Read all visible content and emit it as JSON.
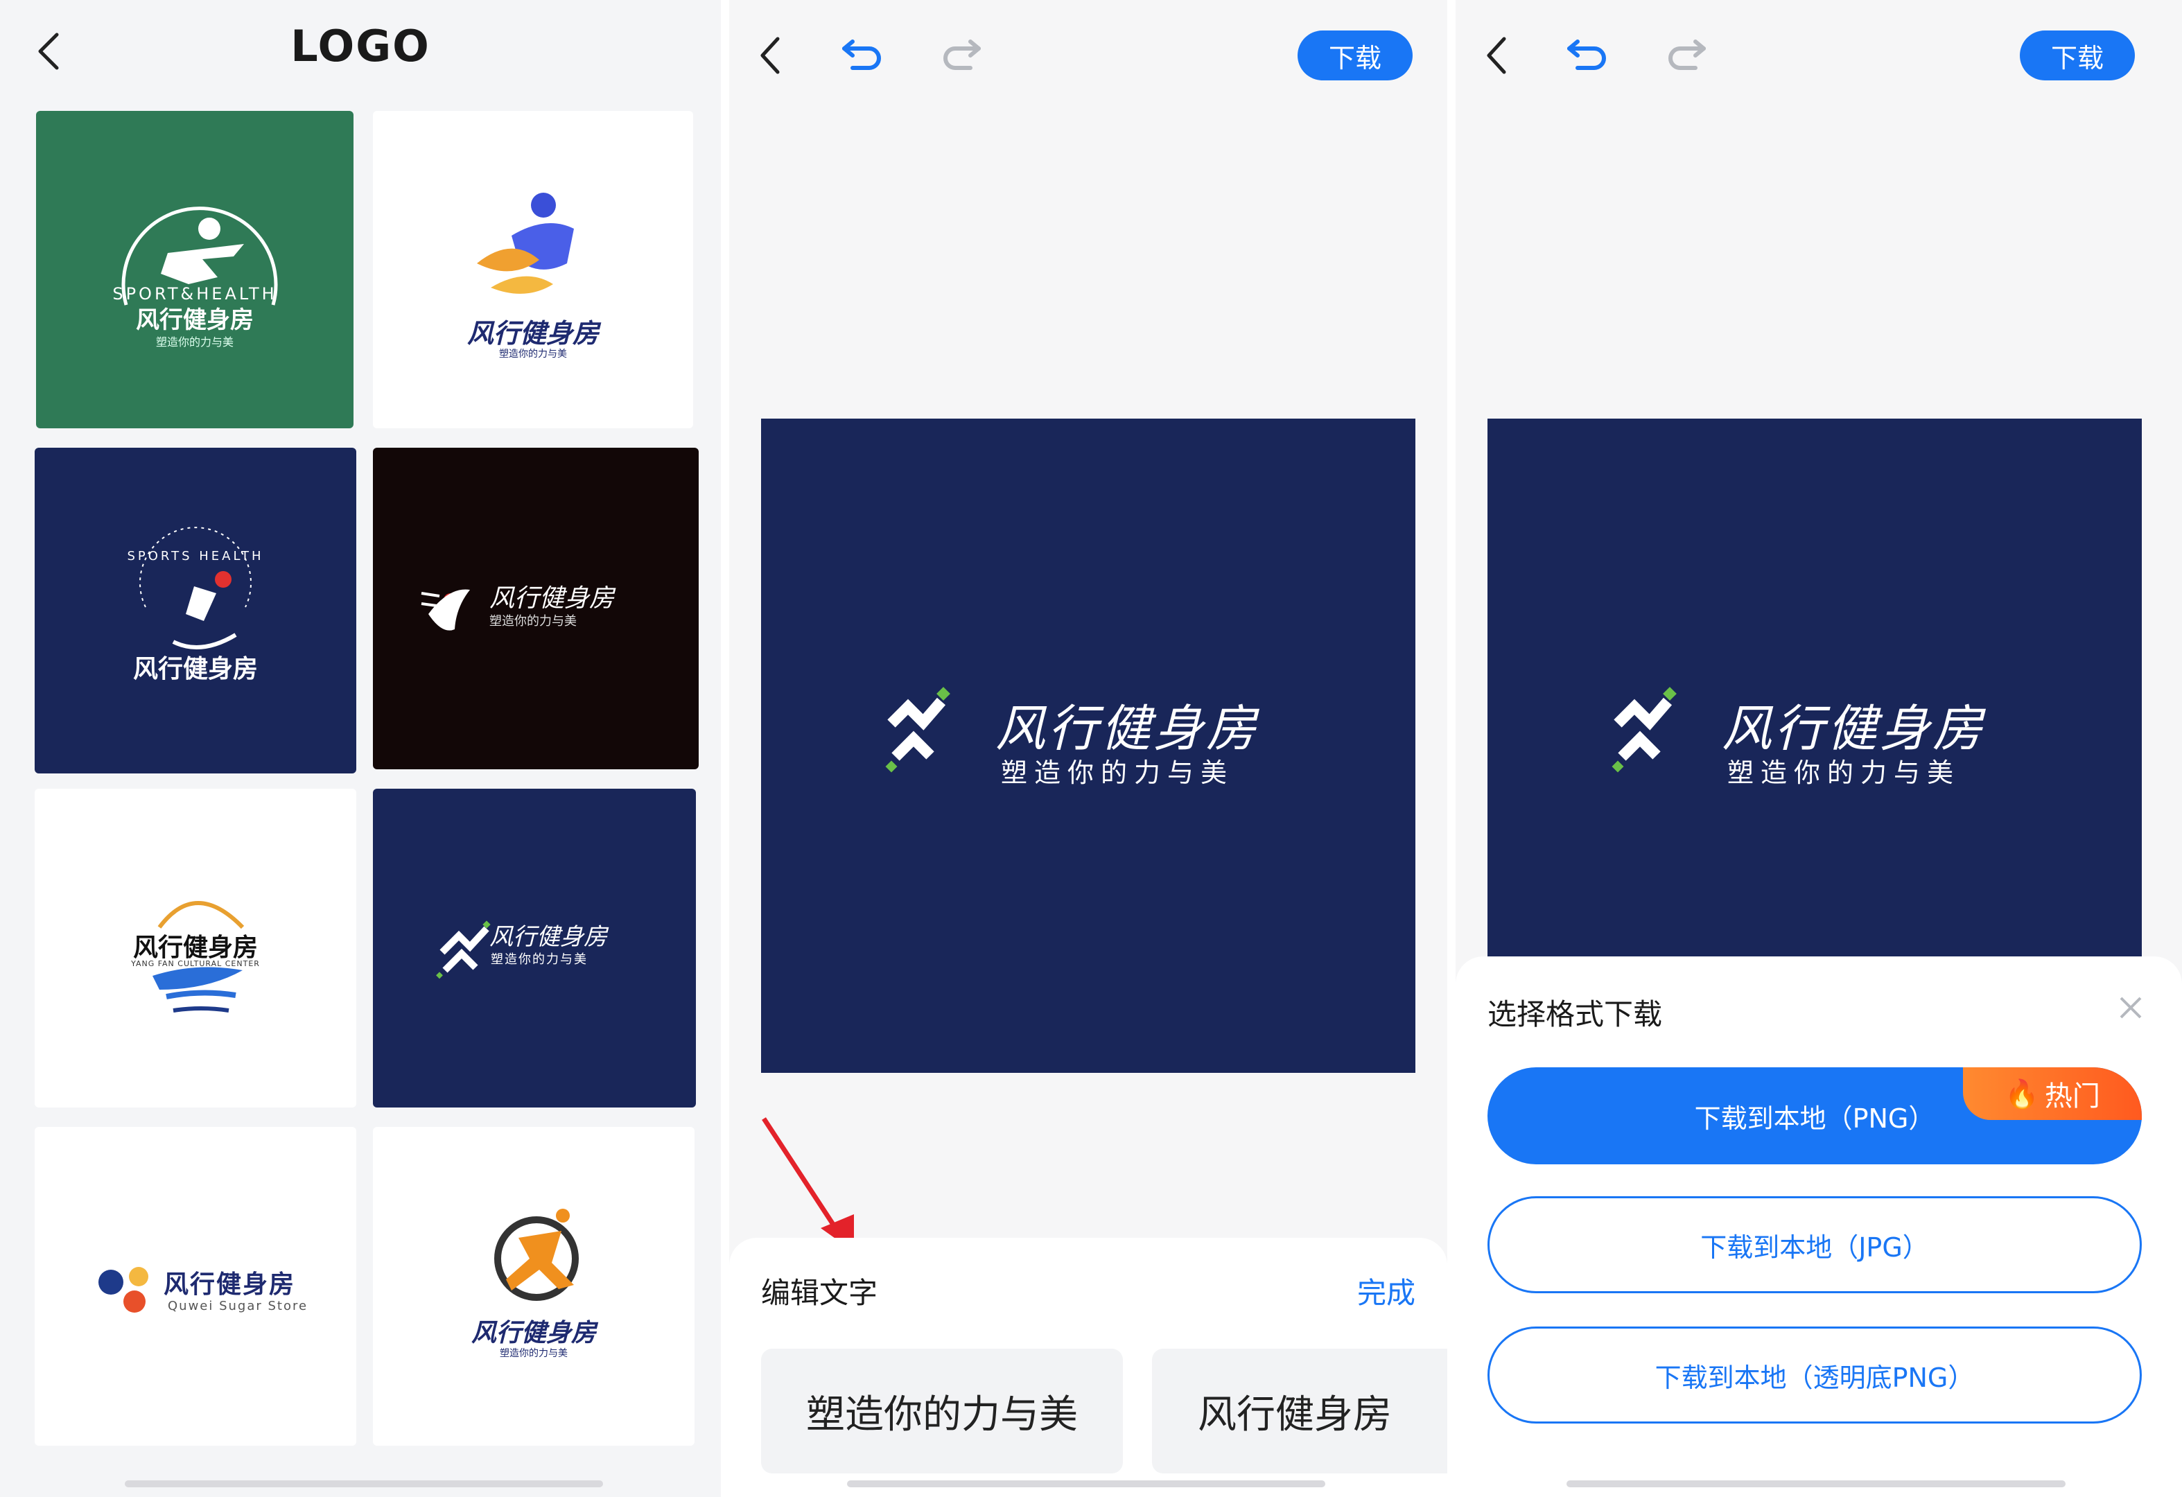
{
  "panel_logo_list": {
    "title": "LOGO",
    "tiles": [
      {
        "name": "风行健身房",
        "tagline": "塑造你的力与美",
        "arc_text": "SPORT&HEALTH",
        "bg": "#2f7a56"
      },
      {
        "name": "风行健身房",
        "tagline": "塑造你的力与美",
        "bg": "#ffffff"
      },
      {
        "name": "风行健身房",
        "arc_text": "SPORTS HEALTH",
        "bg": "#192659"
      },
      {
        "name": "风行健身房",
        "tagline": "塑造你的力与美",
        "bg": "#120707"
      },
      {
        "name": "风行健身房",
        "tagline": "YANG FAN CULTURAL CENTER",
        "bg": "#ffffff"
      },
      {
        "name": "风行健身房",
        "tagline": "塑造你的力与美",
        "bg": "#192659"
      },
      {
        "name": "风行健身房",
        "tagline": "Quwei Sugar Store",
        "bg": "#ffffff"
      },
      {
        "name": "风行健身房",
        "tagline": "塑造你的力与美",
        "bg": "#ffffff"
      }
    ]
  },
  "editor": {
    "download_label": "下载",
    "canvas_name": "风行健身房",
    "canvas_tagline": "塑造你的力与美",
    "sheet_title": "编辑文字",
    "done_label": "完成",
    "chips": [
      "塑造你的力与美",
      "风行健身房"
    ]
  },
  "download": {
    "download_label": "下载",
    "canvas_name": "风行健身房",
    "canvas_tagline": "塑造你的力与美",
    "sheet_title": "选择格式下载",
    "hot_badge": "热门",
    "options": [
      "下载到本地（PNG）",
      "下载到本地（JPG）",
      "下载到本地（透明底PNG）"
    ]
  },
  "colors": {
    "accent": "#1976f5",
    "canvas": "#192659",
    "green": "#2f7a56",
    "hot": "#ff6a24"
  }
}
